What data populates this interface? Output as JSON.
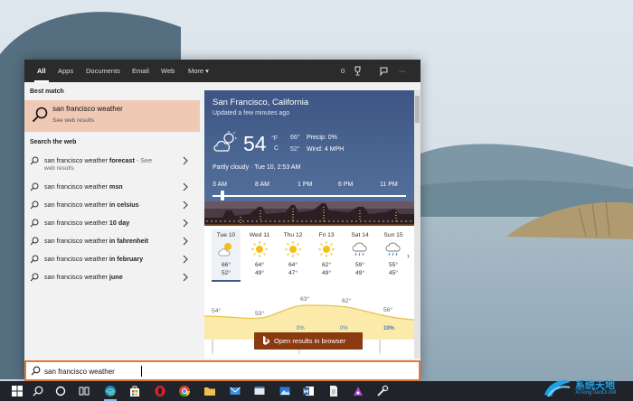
{
  "tabs": [
    {
      "label": "All",
      "active": true
    },
    {
      "label": "Apps"
    },
    {
      "label": "Documents"
    },
    {
      "label": "Email"
    },
    {
      "label": "Web"
    },
    {
      "label": "More ▾"
    }
  ],
  "toolbar": {
    "rewards_count": "0",
    "more": "···"
  },
  "best_match": {
    "section_label": "Best match",
    "title": "san francisco weather",
    "subtitle": "See web results"
  },
  "web": {
    "section_label": "Search the web",
    "suggestions": [
      {
        "prefix": "san francisco weather ",
        "bold": "forecast",
        "suffix": " - See",
        "line2": "web results"
      },
      {
        "prefix": "san francisco weather ",
        "bold": "msn",
        "suffix": ""
      },
      {
        "prefix": "san francisco weather ",
        "bold": "in celsius",
        "suffix": ""
      },
      {
        "prefix": "san francisco weather ",
        "bold": "10 day",
        "suffix": ""
      },
      {
        "prefix": "san francisco weather ",
        "bold": "in fahrenheit",
        "suffix": ""
      },
      {
        "prefix": "san francisco weather ",
        "bold": "in february",
        "suffix": ""
      },
      {
        "prefix": "san francisco weather ",
        "bold": "june",
        "suffix": ""
      }
    ]
  },
  "weather": {
    "city": "San Francisco, California",
    "updated": "Updated a few minutes ago",
    "temp": "54",
    "unit_f": "°F",
    "unit_c": "C",
    "hi": "66°",
    "lo": "52°",
    "precip": "Precip: 0%",
    "wind": "Wind: 4 MPH",
    "condition": "Partly cloudy · Tue 10, 2:53 AM",
    "hours": [
      "3 AM",
      "8 AM",
      "1 PM",
      "6 PM",
      "11 PM"
    ],
    "days": [
      {
        "name": "Tue 10",
        "hi": "66°",
        "lo": "52°",
        "icon": "partly-cloudy",
        "selected": true
      },
      {
        "name": "Wed 11",
        "hi": "64°",
        "lo": "49°",
        "icon": "sun"
      },
      {
        "name": "Thu 12",
        "hi": "64°",
        "lo": "47°",
        "icon": "sun"
      },
      {
        "name": "Fri 13",
        "hi": "62°",
        "lo": "49°",
        "icon": "sun"
      },
      {
        "name": "Sat 14",
        "hi": "59°",
        "lo": "49°",
        "icon": "rain"
      },
      {
        "name": "Sun 15",
        "hi": "55°",
        "lo": "45°",
        "icon": "rain"
      }
    ],
    "graph_temps": [
      "54°",
      "53°",
      "63°",
      "62°",
      "56°"
    ],
    "graph_precip": [
      "0%",
      "0%",
      "10%"
    ],
    "open_button": "Open results in browser"
  },
  "search": {
    "value": "san francisco weather"
  },
  "watermark": {
    "text": "系统天地",
    "url": "XiTongTianDi.net"
  }
}
